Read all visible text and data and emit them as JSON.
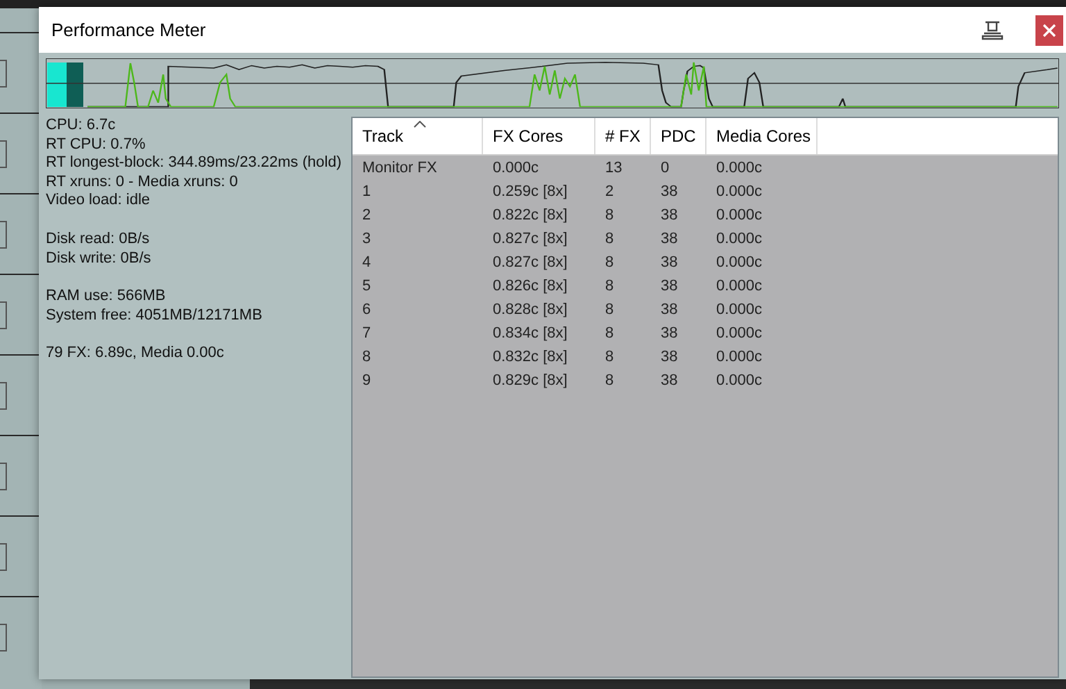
{
  "window": {
    "title": "Performance Meter"
  },
  "stats": [
    [
      "CPU: 6.7c",
      "RT CPU: 0.7%",
      "RT longest-block: 344.89ms/23.22ms (hold)",
      "RT xruns: 0 - Media xruns: 0",
      "Video load: idle"
    ],
    [
      "Disk read: 0B/s",
      "Disk write: 0B/s"
    ],
    [
      "RAM use: 566MB",
      "System free: 4051MB/12171MB"
    ],
    [
      "79 FX: 6.89c, Media 0.00c"
    ]
  ],
  "table": {
    "columns": [
      {
        "label": "Track",
        "sorted": true
      },
      {
        "label": "FX Cores",
        "sorted": false
      },
      {
        "label": "# FX",
        "sorted": false
      },
      {
        "label": "PDC",
        "sorted": false
      },
      {
        "label": "Media Cores",
        "sorted": false
      }
    ],
    "rows": [
      [
        "Monitor FX",
        "0.000c",
        "13",
        "0",
        "0.000c"
      ],
      [
        "1",
        "0.259c [8x]",
        "2",
        "38",
        "0.000c"
      ],
      [
        "2",
        "0.822c [8x]",
        "8",
        "38",
        "0.000c"
      ],
      [
        "3",
        "0.827c [8x]",
        "8",
        "38",
        "0.000c"
      ],
      [
        "4",
        "0.827c [8x]",
        "8",
        "38",
        "0.000c"
      ],
      [
        "5",
        "0.826c [8x]",
        "8",
        "38",
        "0.000c"
      ],
      [
        "6",
        "0.828c [8x]",
        "8",
        "38",
        "0.000c"
      ],
      [
        "7",
        "0.834c [8x]",
        "8",
        "38",
        "0.000c"
      ],
      [
        "8",
        "0.832c [8x]",
        "8",
        "38",
        "0.000c"
      ],
      [
        "9",
        "0.829c [8x]",
        "8",
        "38",
        "0.000c"
      ]
    ]
  }
}
